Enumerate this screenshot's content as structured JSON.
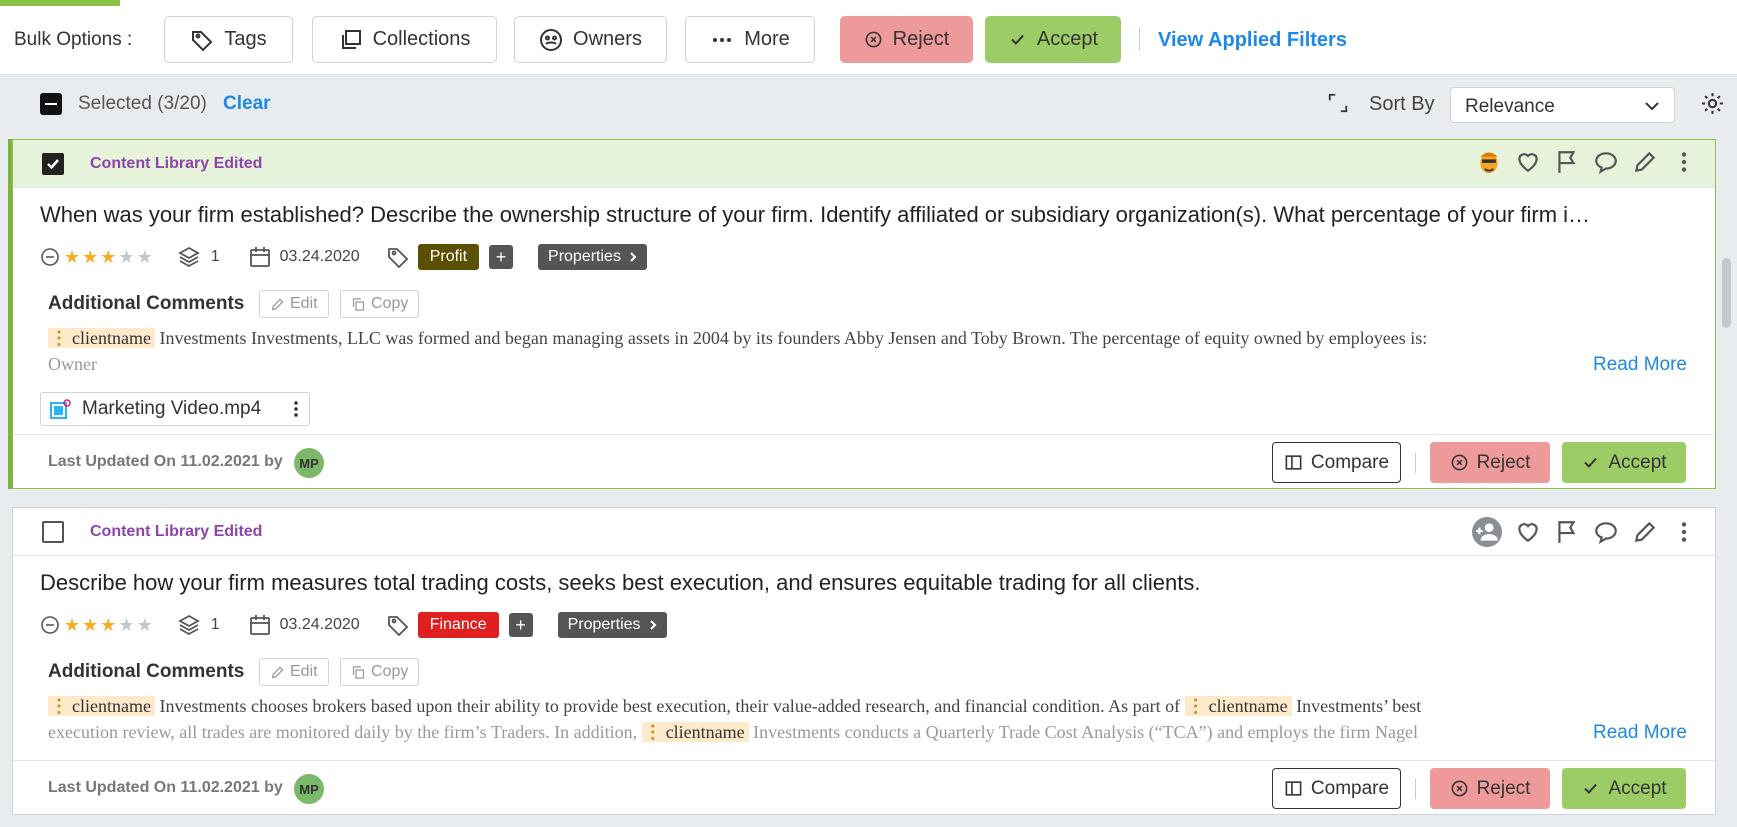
{
  "bulk": {
    "label": "Bulk Options :",
    "tags": "Tags",
    "collections": "Collections",
    "owners": "Owners",
    "more": "More",
    "reject": "Reject",
    "accept": "Accept",
    "view_filters": "View Applied Filters"
  },
  "selection": {
    "selected_text": "Selected (3/20)",
    "clear": "Clear",
    "sort_label": "Sort By",
    "sort_value": "Relevance"
  },
  "cards": [
    {
      "checked": true,
      "status": "Content Library Edited",
      "question": "When was your firm established? Describe the ownership structure of your firm. Identify affiliated or subsidiary organization(s). What percentage of your firm i…",
      "rating": 3,
      "rating_max": 5,
      "versions": "1",
      "date": "03.24.2020",
      "tag": "Profit",
      "tag_color": "#5a5000",
      "plus": "+",
      "properties": "Properties",
      "comments_label": "Additional Comments",
      "edit": "Edit",
      "copy": "Copy",
      "chip": "clientname",
      "comment_text": "Investments Investments, LLC was formed and began managing assets in 2004 by its founders Abby Jensen and Toby Brown. The percentage of equity owned by employees is:",
      "comment_line2": "Owner",
      "read_more": "Read More",
      "file": "Marketing Video.mp4",
      "updated": "Last Updated On 11.02.2021 by",
      "user_initials": "MP",
      "compare": "Compare",
      "reject": "Reject",
      "accept": "Accept"
    },
    {
      "checked": false,
      "status": "Content Library Edited",
      "question": "Describe how your firm measures total trading costs, seeks best execution, and ensures equitable trading for all clients.",
      "rating": 3,
      "rating_max": 5,
      "versions": "1",
      "date": "03.24.2020",
      "tag": "Finance",
      "tag_color": "#e02020",
      "plus": "+",
      "properties": "Properties",
      "comments_label": "Additional Comments",
      "edit": "Edit",
      "copy": "Copy",
      "chip": "clientname",
      "comment_text_a": "Investments chooses brokers based upon their ability to provide best execution, their value-added research, and financial condition. As part of",
      "comment_text_b": "Investments’ best",
      "comment_text_c": "execution review, all trades are monitored daily by the firm’s Traders. In addition,",
      "comment_text_d": "Investments conducts a Quarterly Trade Cost Analysis (“TCA”) and employs the firm Nagel",
      "read_more": "Read More",
      "updated": "Last Updated On 11.02.2021 by",
      "user_initials": "MP",
      "compare": "Compare",
      "reject": "Reject",
      "accept": "Accept"
    }
  ],
  "colors": {
    "accent": "#1e88e5",
    "reject": "#ef9a9a",
    "accept": "#9ccc65",
    "status": "#8e44ad"
  }
}
